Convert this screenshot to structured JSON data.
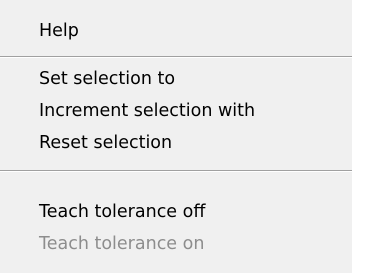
{
  "menu": {
    "groups": [
      {
        "items": [
          {
            "label": "Help",
            "enabled": true
          }
        ]
      },
      {
        "items": [
          {
            "label": "Set selection to",
            "enabled": true
          },
          {
            "label": "Increment selection with",
            "enabled": true
          },
          {
            "label": "Reset selection",
            "enabled": true
          }
        ]
      },
      {
        "items": [
          {
            "label": "Teach tolerance off",
            "enabled": true
          },
          {
            "label": "Teach tolerance on",
            "enabled": false
          }
        ]
      }
    ]
  }
}
